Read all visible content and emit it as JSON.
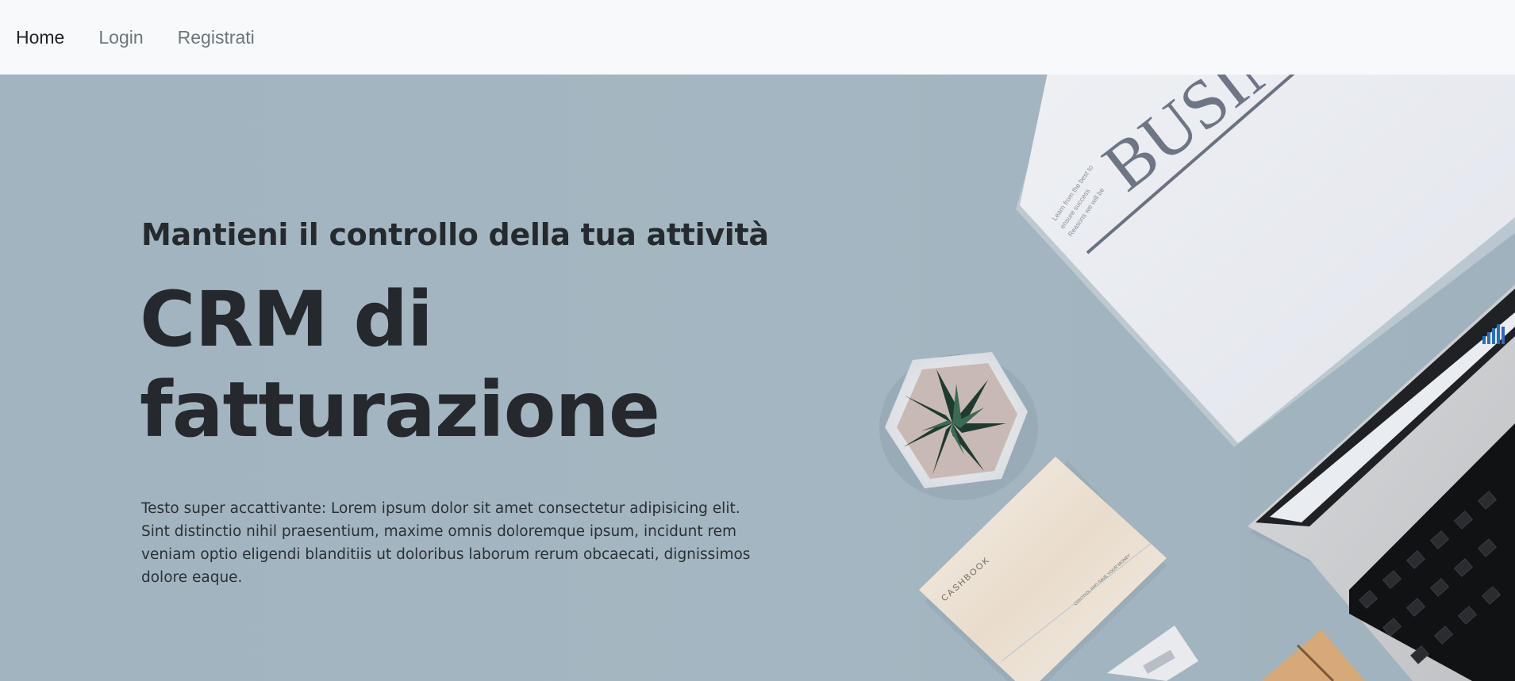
{
  "nav": {
    "items": [
      {
        "label": "Home",
        "active": true
      },
      {
        "label": "Login",
        "active": false
      },
      {
        "label": "Registrati",
        "active": false
      }
    ]
  },
  "hero": {
    "subtitle": "Mantieni il controllo della tua attività",
    "title_line1": "CRM di",
    "title_line2": "fatturazione",
    "text": "Testo super accattivante: Lorem ipsum dolor sit amet consectetur adipisicing elit. Sint distinctio nihil praesentium, maxime omnis doloremque ipsum, incidunt rem veniam optio eligendi blanditiis ut doloribus laborum rerum obcaecati, dignissimos dolore eaque."
  },
  "image": {
    "newspaper_headline": "BUSIN",
    "newspaper_caption": "Learn from the best to ensure success. Reasons we will be successful",
    "notebook_title": "CASHBOOK",
    "notebook_subtitle": "CONTROL AND SAVE YOUR MONEY"
  },
  "colors": {
    "navbar_bg": "#f8f9fa",
    "hero_bg": "#a3b5c0",
    "text_dark": "#212529",
    "nav_muted": "#6c757d"
  }
}
